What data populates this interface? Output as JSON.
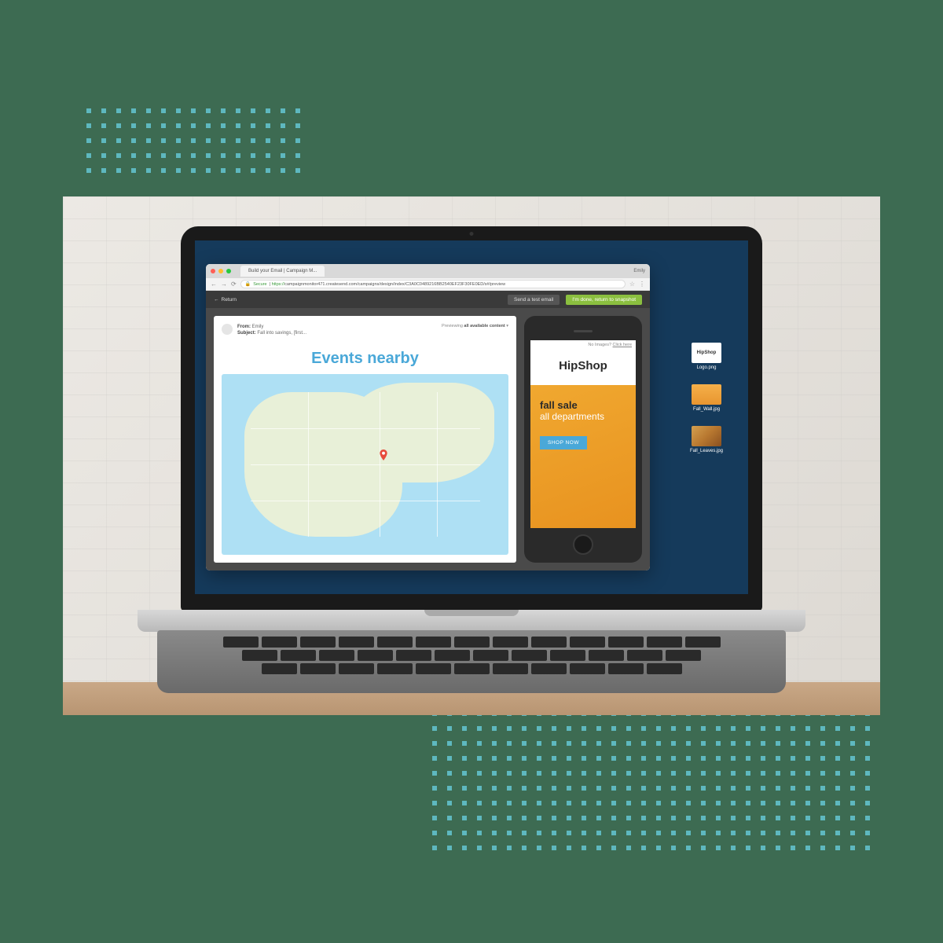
{
  "browser": {
    "tab_title": "Build your Email | Campaign M...",
    "user": "Emily",
    "secure_label": "Secure",
    "url_protocol": "https://",
    "url_rest": "campaignmonitor471.createsend.com/campaigns/design/index/C3A0C0489216BB2540EF23F30FE0ED/s#/preview"
  },
  "toolbar": {
    "return_label": "Return",
    "send_test_label": "Send a test email",
    "done_label": "I'm done, return to snapshot"
  },
  "email": {
    "from_label": "From:",
    "from_value": "Emily",
    "subject_label": "Subject:",
    "subject_value": "Fall into savings, [first...",
    "preview_prefix": "Previewing",
    "preview_value": "all available content",
    "heading": "Events nearby"
  },
  "phone": {
    "no_images_text": "No Images?",
    "no_images_link": "Click here",
    "brand": "HipShop",
    "hero_line1": "fall sale",
    "hero_line2": "all departments",
    "cta": "SHOP NOW"
  },
  "desktop_files": [
    {
      "thumb_text": "HipShop",
      "label": "Logo.png",
      "thumb_class": ""
    },
    {
      "thumb_text": "",
      "label": "Fall_Wall.jpg",
      "thumb_class": "thumb-wall"
    },
    {
      "thumb_text": "",
      "label": "Fall_Leaves.jpg",
      "thumb_class": "thumb-leaves"
    }
  ]
}
